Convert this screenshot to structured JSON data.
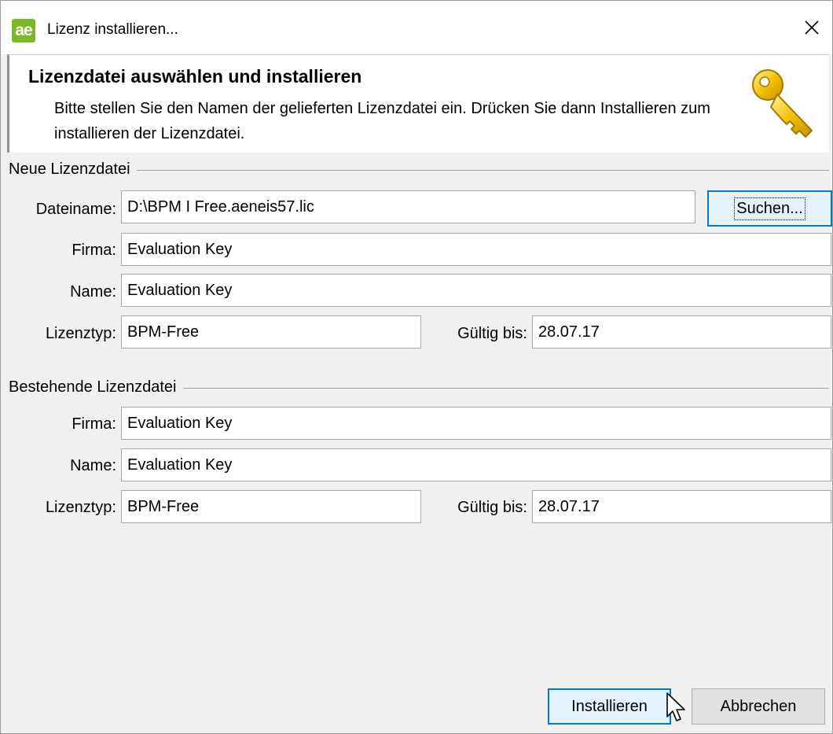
{
  "window": {
    "title": "Lizenz installieren...",
    "app_icon_text": "ae",
    "close_icon": "close-icon"
  },
  "header": {
    "title": "Lizenzdatei auswählen und installieren",
    "description": "Bitte stellen Sie den Namen der gelieferten Lizenzdatei ein. Drücken Sie dann Installieren zum installieren der Lizenzdatei.",
    "icon": "key-icon"
  },
  "new_license": {
    "group_label": "Neue Lizenzdatei",
    "filename_label": "Dateiname:",
    "filename_value": "D:\\BPM I Free.aeneis57.lic",
    "browse_button": "Suchen...",
    "company_label": "Firma:",
    "company_value": "Evaluation Key",
    "name_label": "Name:",
    "name_value": "Evaluation Key",
    "type_label": "Lizenztyp:",
    "type_value": "BPM-Free",
    "valid_label": "Gültig bis:",
    "valid_value": "28.07.17"
  },
  "existing_license": {
    "group_label": "Bestehende Lizenzdatei",
    "company_label": "Firma:",
    "company_value": "Evaluation Key",
    "name_label": "Name:",
    "name_value": "Evaluation Key",
    "type_label": "Lizenztyp:",
    "type_value": "BPM-Free",
    "valid_label": "Gültig bis:",
    "valid_value": "28.07.17"
  },
  "footer": {
    "install_button": "Installieren",
    "cancel_button": "Abbrechen"
  },
  "colors": {
    "accent": "#0078d7",
    "app_icon": "#7bb929",
    "key": "#f2c200"
  }
}
